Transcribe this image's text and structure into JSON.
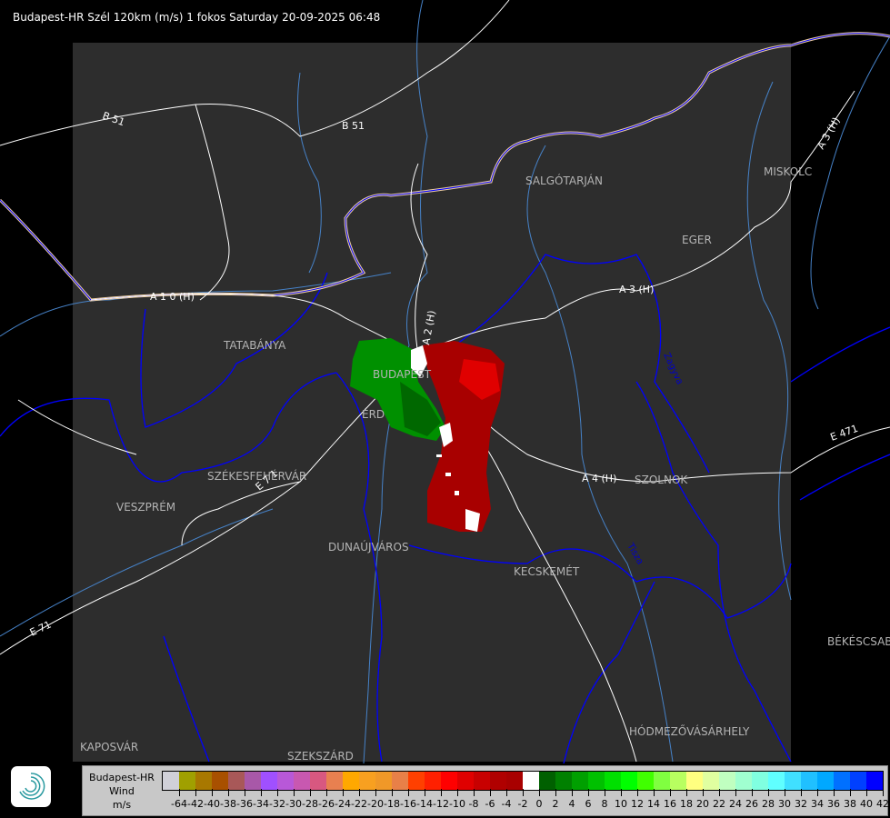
{
  "title": "Budapest-HR Szél 120km (m/s) 1 fokos Saturday 20-09-2025 06:48",
  "map": {
    "cities": [
      {
        "name": "TATABÁNYA"
      },
      {
        "name": "BUDAPEST"
      },
      {
        "name": "ÉRD"
      },
      {
        "name": "SZÉKESFEHÉRVÁR"
      },
      {
        "name": "VESZPRÉM"
      },
      {
        "name": "DUNAÚJVÁROS"
      },
      {
        "name": "KECSKEMÉT"
      },
      {
        "name": "SALGÓTARJÁN"
      },
      {
        "name": "EGER"
      },
      {
        "name": "MISKOLC"
      },
      {
        "name": "SZOLNOK"
      },
      {
        "name": "BÉKÉSCSABA"
      },
      {
        "name": "HÓDMEZŐVÁSÁRHELY"
      },
      {
        "name": "KAPOSVÁR"
      },
      {
        "name": "SZEKSZÁRD"
      }
    ],
    "roads": [
      {
        "name": "B 51"
      },
      {
        "name": "B 51"
      },
      {
        "name": "A 1 0 (H)"
      },
      {
        "name": "A 2 (H)"
      },
      {
        "name": "A 3 (H)"
      },
      {
        "name": "A 3 (H)"
      },
      {
        "name": "A 4 (H)"
      },
      {
        "name": "E 471"
      },
      {
        "name": "E 7 1"
      },
      {
        "name": "E 71"
      }
    ],
    "rivers": [
      {
        "name": "Zagyva"
      },
      {
        "name": "Tisza"
      }
    ]
  },
  "legend": {
    "station": "Budapest-HR",
    "quantity": "Wind",
    "unit": "m/s",
    "colors": [
      "#d0d0d8",
      "#a0a000",
      "#a87800",
      "#a85000",
      "#a85858",
      "#a858a8",
      "#a050ff",
      "#b858d8",
      "#c858b0",
      "#d85880",
      "#e88050",
      "#ffa800",
      "#f8a020",
      "#f09828",
      "#e88048",
      "#ff4000",
      "#ff2000",
      "#ff0000",
      "#e00000",
      "#c80000",
      "#b00000",
      "#a80000",
      "#ffffff",
      "#006000",
      "#008000",
      "#00a000",
      "#00c000",
      "#00e000",
      "#00ff00",
      "#40ff00",
      "#80ff40",
      "#b8ff60",
      "#ffff80",
      "#e0ffa0",
      "#c0ffc0",
      "#a0ffd0",
      "#80ffe0",
      "#60ffff",
      "#40e0ff",
      "#20c0ff",
      "#00a8ff",
      "#0070ff",
      "#0040ff",
      "#0000ff"
    ],
    "ticks": [
      "-64",
      "-42",
      "-40",
      "-38",
      "-36",
      "-34",
      "-32",
      "-30",
      "-28",
      "-26",
      "-24",
      "-22",
      "-20",
      "-18",
      "-16",
      "-14",
      "-12",
      "-10",
      "-8",
      "-6",
      "-4",
      "-2",
      "0",
      "2",
      "4",
      "6",
      "8",
      "10",
      "12",
      "14",
      "16",
      "18",
      "20",
      "22",
      "24",
      "26",
      "28",
      "30",
      "32",
      "34",
      "36",
      "38",
      "40",
      "42"
    ]
  },
  "colors": {
    "background": "#000000",
    "radar_area": "#2d2d2d",
    "border": "#0000ff",
    "river": "#4682c8",
    "road": "#ffffff",
    "city": "#b4b4b4"
  }
}
